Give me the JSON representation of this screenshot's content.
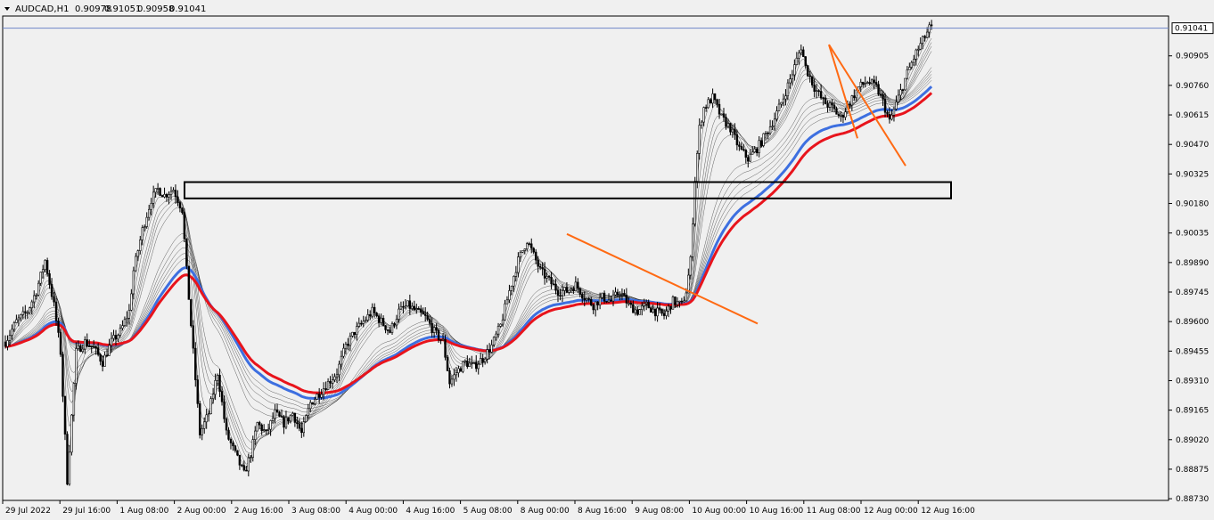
{
  "chart_data": {
    "type": "candlestick",
    "header": {
      "symbol": "AUDCAD,H1",
      "open": "0.90978",
      "high": "0.91051",
      "low": "0.90958",
      "close": "0.91041"
    },
    "current_price": "0.91041",
    "y_ticks": [
      "0.90905",
      "0.90760",
      "0.90615",
      "0.90470",
      "0.90325",
      "0.90180",
      "0.90035",
      "0.89890",
      "0.89745",
      "0.89600",
      "0.89455",
      "0.89310",
      "0.89165",
      "0.89020",
      "0.88875",
      "0.88730"
    ],
    "ylim": [
      0.8873,
      0.911
    ],
    "x_ticks": [
      "29 Jul 2022",
      "29 Jul 16:00",
      "1 Aug 08:00",
      "2 Aug 00:00",
      "2 Aug 16:00",
      "3 Aug 08:00",
      "4 Aug 00:00",
      "4 Aug 16:00",
      "5 Aug 08:00",
      "8 Aug 00:00",
      "8 Aug 16:00",
      "9 Aug 08:00",
      "10 Aug 00:00",
      "10 Aug 16:00",
      "11 Aug 08:00",
      "12 Aug 00:00",
      "12 Aug 16:00"
    ],
    "close_path": [
      [
        0,
        0.895
      ],
      [
        5,
        0.896
      ],
      [
        10,
        0.8965
      ],
      [
        14,
        0.8975
      ],
      [
        18,
        0.899
      ],
      [
        22,
        0.8968
      ],
      [
        25,
        0.8945
      ],
      [
        28,
        0.8882
      ],
      [
        32,
        0.8945
      ],
      [
        36,
        0.895
      ],
      [
        40,
        0.8947
      ],
      [
        44,
        0.894
      ],
      [
        48,
        0.895
      ],
      [
        52,
        0.8955
      ],
      [
        56,
        0.8965
      ],
      [
        58,
        0.8985
      ],
      [
        62,
        0.9005
      ],
      [
        66,
        0.902
      ],
      [
        69,
        0.9025
      ],
      [
        72,
        0.9022
      ],
      [
        76,
        0.9025
      ],
      [
        80,
        0.9015
      ],
      [
        82,
        0.8985
      ],
      [
        85,
        0.8945
      ],
      [
        88,
        0.8905
      ],
      [
        92,
        0.8915
      ],
      [
        96,
        0.8935
      ],
      [
        100,
        0.8905
      ],
      [
        104,
        0.8895
      ],
      [
        108,
        0.8885
      ],
      [
        111,
        0.8895
      ],
      [
        114,
        0.891
      ],
      [
        118,
        0.8905
      ],
      [
        122,
        0.8915
      ],
      [
        126,
        0.891
      ],
      [
        130,
        0.8915
      ],
      [
        134,
        0.8905
      ],
      [
        138,
        0.892
      ],
      [
        142,
        0.8925
      ],
      [
        146,
        0.893
      ],
      [
        150,
        0.8935
      ],
      [
        154,
        0.8948
      ],
      [
        158,
        0.8955
      ],
      [
        162,
        0.896
      ],
      [
        166,
        0.8965
      ],
      [
        170,
        0.896
      ],
      [
        174,
        0.8955
      ],
      [
        178,
        0.8965
      ],
      [
        182,
        0.8968
      ],
      [
        186,
        0.8965
      ],
      [
        190,
        0.8962
      ],
      [
        194,
        0.8955
      ],
      [
        198,
        0.895
      ],
      [
        201,
        0.893
      ],
      [
        204,
        0.8935
      ],
      [
        208,
        0.894
      ],
      [
        212,
        0.8938
      ],
      [
        216,
        0.8942
      ],
      [
        220,
        0.8948
      ],
      [
        224,
        0.8958
      ],
      [
        228,
        0.8975
      ],
      [
        232,
        0.899
      ],
      [
        236,
        0.9
      ],
      [
        238,
        0.8995
      ],
      [
        242,
        0.8985
      ],
      [
        246,
        0.898
      ],
      [
        250,
        0.8975
      ],
      [
        254,
        0.8975
      ],
      [
        258,
        0.8978
      ],
      [
        262,
        0.8972
      ],
      [
        266,
        0.8968
      ],
      [
        270,
        0.8972
      ],
      [
        274,
        0.897
      ],
      [
        278,
        0.8975
      ],
      [
        282,
        0.8968
      ],
      [
        286,
        0.8965
      ],
      [
        290,
        0.8968
      ],
      [
        294,
        0.8965
      ],
      [
        298,
        0.8963
      ],
      [
        302,
        0.897
      ],
      [
        306,
        0.8968
      ],
      [
        308,
        0.8975
      ],
      [
        310,
        0.899
      ],
      [
        312,
        0.903
      ],
      [
        314,
        0.9055
      ],
      [
        316,
        0.9065
      ],
      [
        320,
        0.907
      ],
      [
        324,
        0.906
      ],
      [
        328,
        0.9055
      ],
      [
        332,
        0.9045
      ],
      [
        336,
        0.904
      ],
      [
        340,
        0.9045
      ],
      [
        344,
        0.9052
      ],
      [
        348,
        0.906
      ],
      [
        352,
        0.907
      ],
      [
        356,
        0.9082
      ],
      [
        360,
        0.9095
      ],
      [
        362,
        0.9085
      ],
      [
        366,
        0.9075
      ],
      [
        370,
        0.9068
      ],
      [
        374,
        0.9065
      ],
      [
        378,
        0.906
      ],
      [
        382,
        0.9068
      ],
      [
        386,
        0.9075
      ],
      [
        390,
        0.9078
      ],
      [
        394,
        0.9075
      ],
      [
        397,
        0.9068
      ],
      [
        400,
        0.9058
      ],
      [
        404,
        0.907
      ],
      [
        408,
        0.9082
      ],
      [
        412,
        0.9092
      ],
      [
        416,
        0.91
      ],
      [
        418,
        0.9104
      ]
    ],
    "bands": {
      "a": 1,
      "b": 1,
      "c": 1,
      "d": 1,
      "e": 1,
      "f": 1,
      "g": 1,
      "h": 1,
      "i": 1,
      "j": 1,
      "k": 1
    },
    "colors": {
      "background": "#f0f0f0",
      "bull": "#ffffff",
      "bear": "#000000",
      "wick": "#000000",
      "ma_fast": "#000000",
      "ma_blue": "#3d6fe0",
      "ma_red": "#e8141c",
      "trendline": "#ff6a13",
      "zone": "#000000",
      "grid_price_line": "#6f86c8"
    }
  }
}
